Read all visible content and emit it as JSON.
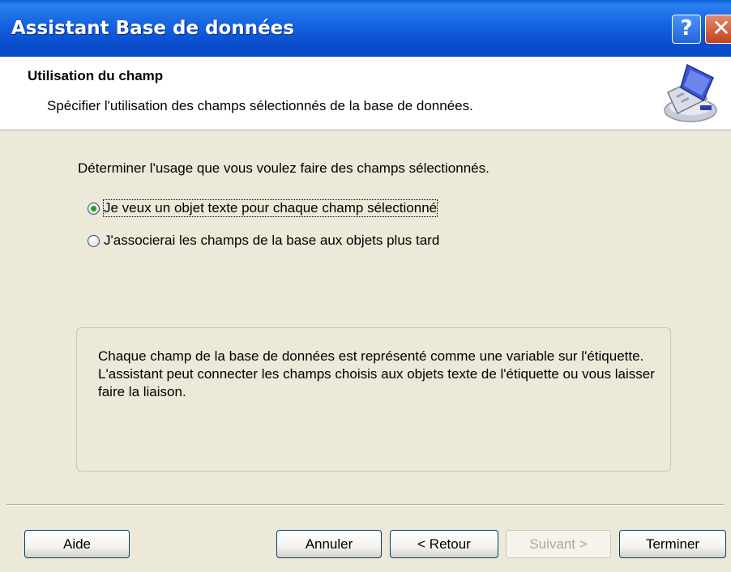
{
  "window": {
    "title": "Assistant Base de données",
    "help_button": "?",
    "close_button": "✕"
  },
  "header": {
    "title": "Utilisation du champ",
    "subtitle": "Spécifier l'utilisation des champs sélectionnés de la base de données.",
    "icon": "database-wizard-icon"
  },
  "body": {
    "instruction": "Déterminer l'usage que vous voulez faire des champs sélectionnés.",
    "options": [
      {
        "label": "Je veux un objet texte pour chaque champ sélectionné",
        "selected": true
      },
      {
        "label": "J'associerai les champs de la base aux objets plus tard",
        "selected": false
      }
    ],
    "info": "Chaque champ de la base de données est représenté comme une variable sur l'étiquette. L'assistant peut connecter les champs choisis aux objets texte de l'étiquette ou vous laisser faire la liaison."
  },
  "buttons": {
    "help": "Aide",
    "cancel": "Annuler",
    "back": "< Retour",
    "next": "Suivant >",
    "finish": "Terminer"
  }
}
